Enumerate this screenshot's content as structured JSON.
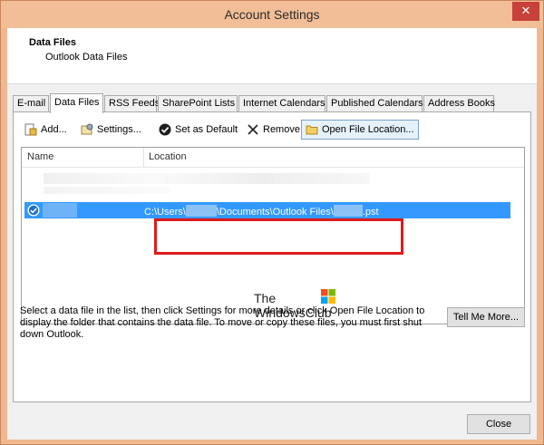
{
  "window": {
    "title": "Account Settings",
    "close_glyph": "✕"
  },
  "header": {
    "title": "Data Files",
    "subtitle": "Outlook Data Files"
  },
  "tabs": [
    {
      "label": "E-mail",
      "active": false
    },
    {
      "label": "Data Files",
      "active": true
    },
    {
      "label": "RSS Feeds",
      "active": false
    },
    {
      "label": "SharePoint Lists",
      "active": false
    },
    {
      "label": "Internet Calendars",
      "active": false
    },
    {
      "label": "Published Calendars",
      "active": false
    },
    {
      "label": "Address Books",
      "active": false
    }
  ],
  "toolbar": {
    "add_label": "Add...",
    "settings_label": "Settings...",
    "set_default_label": "Set as Default",
    "remove_label": "Remove",
    "open_location_label": "Open File Location..."
  },
  "list": {
    "col_name": "Name",
    "col_location": "Location",
    "selected_row": {
      "path_prefix": "C:\\Users\\",
      "path_middle": "\\Documents\\Outlook Files\\",
      "path_suffix": ".pst"
    }
  },
  "watermark": {
    "line1": "The",
    "line2": "WindowsClub"
  },
  "description": "Select a data file in the list, then click Settings for more details or click Open File Location to display the folder that contains the data file. To move or copy these files, you must first shut down Outlook.",
  "buttons": {
    "tell_me_more": "Tell Me More...",
    "close": "Close"
  },
  "colors": {
    "selection": "#3399ff",
    "highlight": "#e01a1a",
    "titlebar": "#f1be97"
  }
}
